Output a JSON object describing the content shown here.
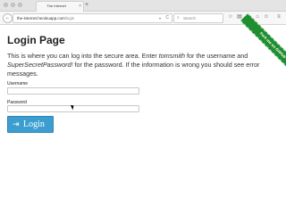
{
  "browser": {
    "tab_title": "The Internet",
    "tab_close": "×",
    "new_tab": "+",
    "url_host": "the-internet.herokuapp.com",
    "url_path": "/login",
    "search_placeholder": "Search",
    "back_glyph": "←",
    "reload_glyph": "C",
    "dropdown_glyph": "▾",
    "search_glyph": "⌕",
    "toolbar": {
      "bookmark": "☆",
      "reading": "▤",
      "downloads": "↓",
      "home": "⌂",
      "sync": "☺",
      "menu": "≡"
    }
  },
  "page": {
    "title": "Login Page",
    "intro_parts": {
      "a": "This is where you can log into the secure area. Enter ",
      "user": "tomsmith",
      "b": " for the username and ",
      "pass": "SuperSecretPassword!",
      "c": " for the password. If the information is wrong you should see error messages."
    },
    "username_label": "Username",
    "username_value": "",
    "password_label": "Password",
    "password_value": "",
    "login_icon": "⇥",
    "login_label": "Login",
    "ribbon_text": "Fork me on GitHub"
  }
}
